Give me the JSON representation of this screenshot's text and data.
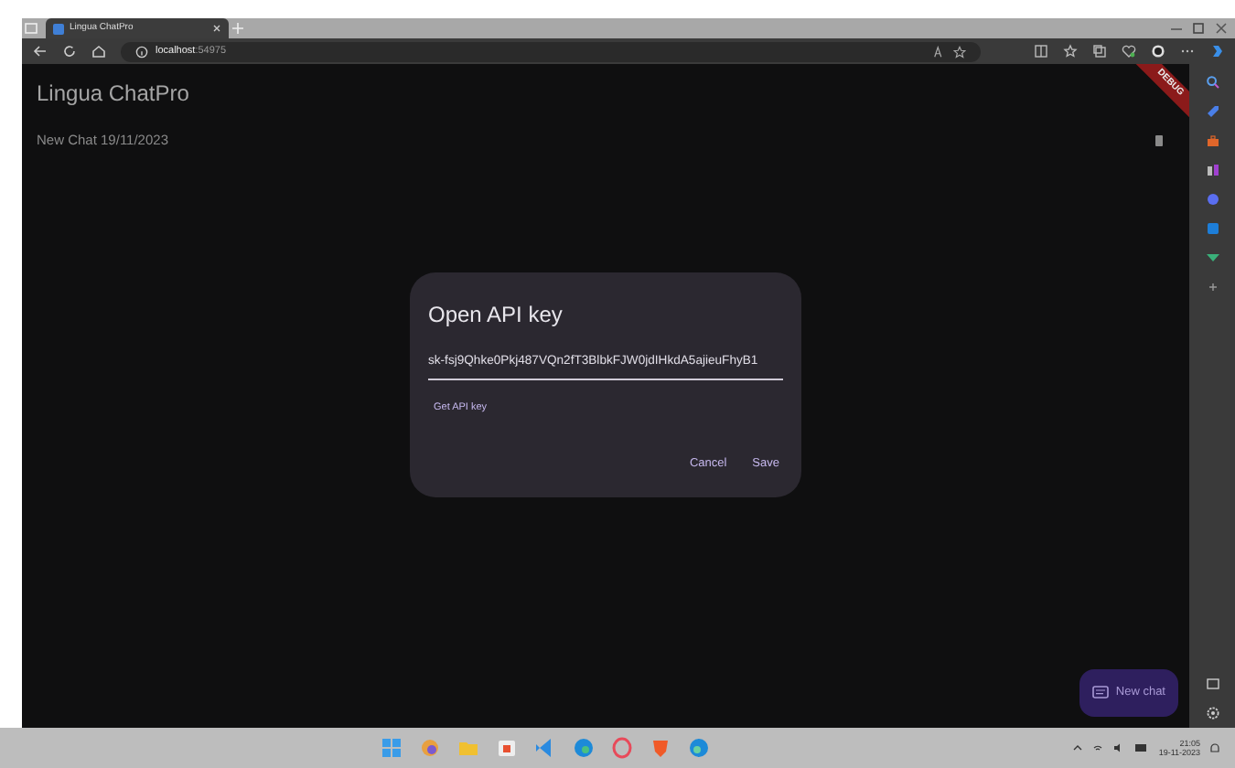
{
  "browser": {
    "tab_title": "Lingua ChatPro",
    "host": "localhost",
    "port": ":54975"
  },
  "app": {
    "title": "Lingua ChatPro",
    "chats": [
      {
        "title": "New Chat 19/11/2023"
      }
    ],
    "debug_banner": "DEBUG",
    "new_chat_button": "New chat"
  },
  "dialog": {
    "title": "Open API key",
    "value": "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",
    "link": "Get API key",
    "buttons": [
      "Cancel",
      "Save"
    ]
  },
  "taskbar": {
    "time": "21:05",
    "date": "19-11-2023"
  }
}
